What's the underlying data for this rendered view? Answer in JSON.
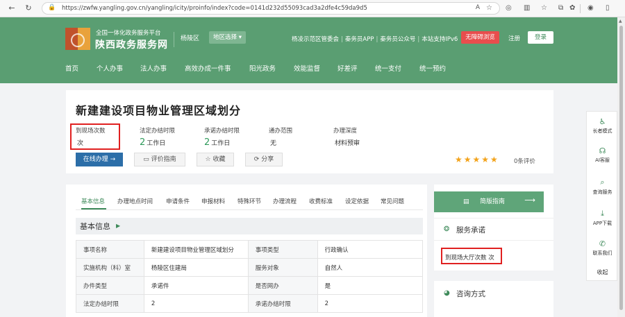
{
  "browser": {
    "url": "https://zwfw.yangling.gov.cn/yangling/icity/proinfo/index?code=0141d232d55093cad3a2dfe4c59da9d5"
  },
  "header": {
    "site_subtitle": "全国一体化政务服务平台",
    "site_title": "陕西政务服务网",
    "region": "杨陵区",
    "region_select": "地区选择 ▾",
    "top_links": [
      "杨凌示范区管委会",
      "秦务员APP",
      "秦务员公众号",
      "本站支持IPv6"
    ],
    "barrier_free": "无障碍浏览",
    "register": "注册",
    "login": "登录",
    "nav": [
      "首页",
      "个人办事",
      "法人办事",
      "高效办成一件事",
      "阳光政务",
      "效能监督",
      "好差评",
      "统一支付",
      "统一预约"
    ]
  },
  "item": {
    "title": "新建建设项目物业管理区域划分",
    "stats": [
      {
        "label": "到现场次数",
        "num": "",
        "unit": "次"
      },
      {
        "label": "法定办结时限",
        "num": "2",
        "unit": "工作日"
      },
      {
        "label": "承诺办结时限",
        "num": "2",
        "unit": "工作日"
      },
      {
        "label": "通办范围",
        "num": "",
        "unit": "无"
      },
      {
        "label": "办理深度",
        "num": "",
        "unit": "材料预审"
      }
    ],
    "btn_online": "在线办理 →",
    "btn_guide": "评价指南",
    "btn_fav": "收藏",
    "btn_share": "分享",
    "rating_stars": 5,
    "rating_text": "0条评价"
  },
  "tabs": [
    "基本信息",
    "办理地点时间",
    "申请条件",
    "申报材料",
    "特殊环节",
    "办理流程",
    "收费标准",
    "设定依据",
    "常见问题"
  ],
  "basic": {
    "title": "基本信息",
    "rows": [
      [
        "事项名称",
        "新建建设项目物业管理区域划分",
        "事项类型",
        "行政确认"
      ],
      [
        "实施机构（科）室",
        "杨陵区住建局",
        "服务对象",
        "自然人"
      ],
      [
        "办件类型",
        "承诺件",
        "是否网办",
        "是"
      ],
      [
        "法定办结时限",
        "2",
        "承诺办结时限",
        "2"
      ]
    ]
  },
  "side": {
    "simple_guide": "简版指南",
    "commitment_title": "服务承诺",
    "commitment_text": "到现场大厅次数  次",
    "contact_title": "咨询方式"
  },
  "float_bar": [
    "长者模式",
    "AI客服",
    "查询服务",
    "APP下载",
    "联系我们",
    "收起"
  ]
}
